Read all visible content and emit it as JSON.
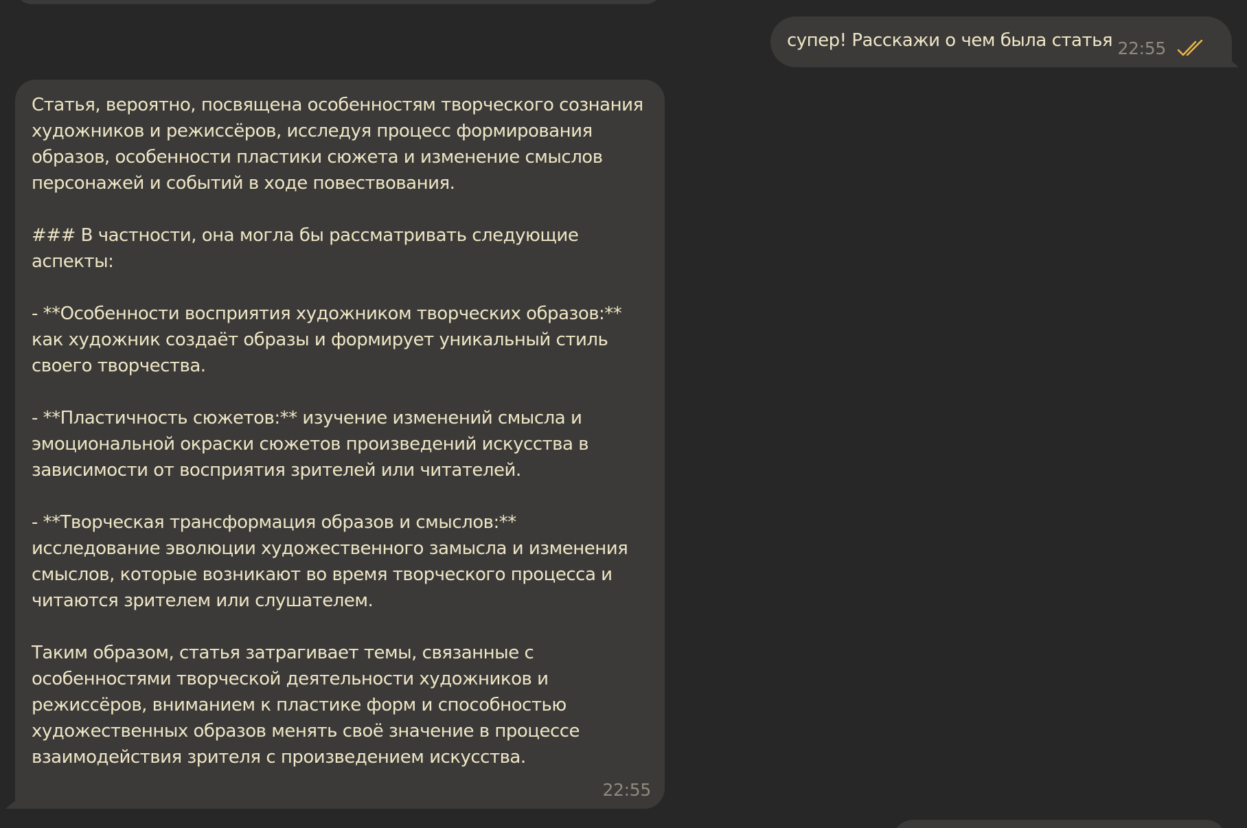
{
  "chat": {
    "outgoing": {
      "text": "супер! Расскажи о чем была статья",
      "time": "22:55",
      "status_icon": "double-check-icon",
      "status_color": "#e8b64a"
    },
    "incoming": {
      "time": "22:55",
      "paragraphs": [
        "Статья, вероятно, посвящена особенностям творческого сознания художников и режиссёров, исследуя процесс формирования образов, особенности пластики сюжета и изменение смыслов персонажей и событий в ходе повествования.",
        "### В частности, она могла бы рассматривать следующие аспекты:",
        "- **Особенности восприятия художником творческих образов:** как художник создаёт образы и формирует уникальный стиль своего творчества.",
        "- **Пластичность сюжетов:** изучение изменений смысла и эмоциональной окраски сюжетов произведений искусства в зависимости от восприятия зрителей или читателей.",
        "- **Творческая трансформация образов и смыслов:** исследование эволюции художественного замысла и изменения смыслов, которые возникают во время творческого процесса и читаются зрителем или слушателем.",
        "Таким образом, статья затрагивает темы, связанные с особенностями творческой деятельности художников и режиссёров, вниманием к пластике форм и способностью художественных образов менять своё значение в процессе взаимодействия зрителя с произведением искусства."
      ]
    }
  },
  "colors": {
    "background": "#272727",
    "bubble": "#3b3a38",
    "text": "#efe6c6",
    "time": "#8f8a80"
  }
}
